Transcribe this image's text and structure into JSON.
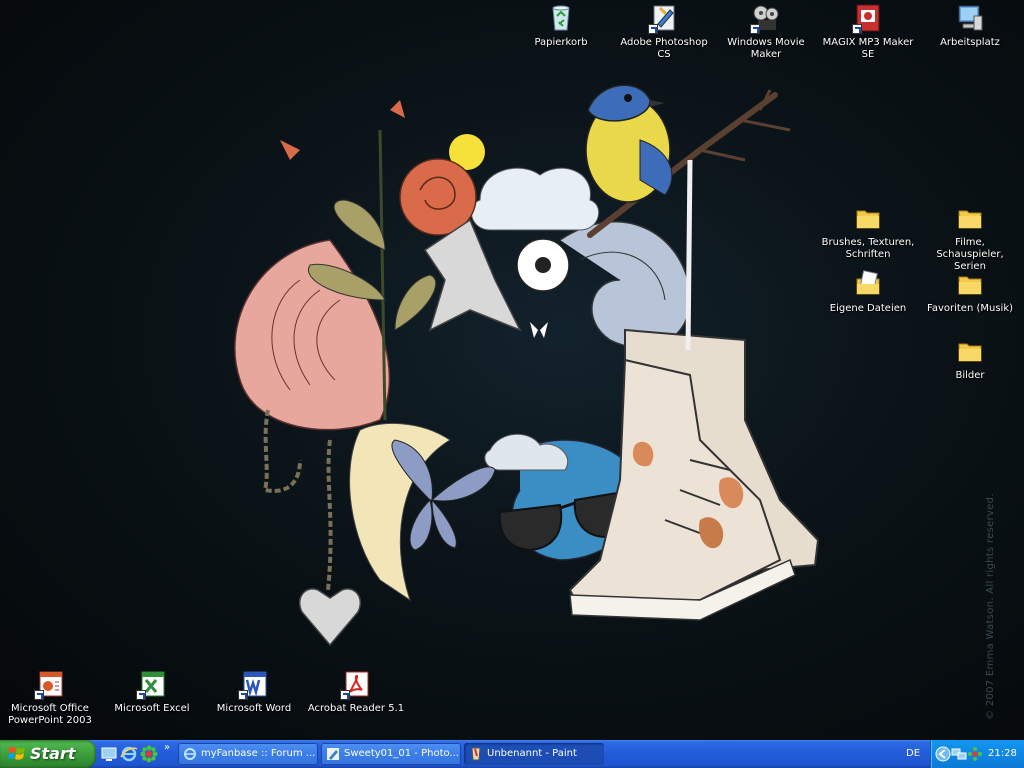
{
  "desktop": {
    "top_icons": [
      {
        "label": "Papierkorb",
        "icon": "recycle-bin-icon"
      },
      {
        "label": "Adobe Photoshop CS",
        "icon": "photoshop-icon"
      },
      {
        "label": "Windows Movie Maker",
        "icon": "movie-maker-icon"
      },
      {
        "label": "MAGIX MP3 Maker SE",
        "icon": "mp3-maker-icon"
      },
      {
        "label": "Arbeitsplatz",
        "icon": "my-computer-icon"
      }
    ],
    "right_icons": [
      {
        "label": "Brushes, Texturen, Schriften",
        "icon": "folder-icon"
      },
      {
        "label": "Filme, Schauspieler, Serien",
        "icon": "folder-icon"
      },
      {
        "label": "Eigene Dateien",
        "icon": "my-documents-icon"
      },
      {
        "label": "Favoriten (Musik)",
        "icon": "folder-icon"
      },
      {
        "label": "Bilder",
        "icon": "folder-icon"
      }
    ],
    "bottom_icons": [
      {
        "label": "Microsoft Office PowerPoint 2003",
        "icon": "powerpoint-icon"
      },
      {
        "label": "Microsoft Excel",
        "icon": "excel-icon"
      },
      {
        "label": "Microsoft Word",
        "icon": "word-icon"
      },
      {
        "label": "Acrobat Reader 5.1",
        "icon": "acrobat-icon"
      }
    ],
    "copyright": "© 2007 Emma Watson. All rights reserved."
  },
  "taskbar": {
    "start_label": "Start",
    "quick_launch": [
      "desktop-icon",
      "internet-explorer-icon",
      "icq-icon"
    ],
    "more_label": "»",
    "tasks": [
      {
        "label": "myFanbase :: Forum ...",
        "icon": "browser-icon",
        "active": false
      },
      {
        "label": "Sweety01_01 - Photo...",
        "icon": "photoshop-icon",
        "active": false
      },
      {
        "label": "Unbenannt - Paint",
        "icon": "paint-icon",
        "active": true
      }
    ],
    "language": "DE",
    "clock": "21:28"
  },
  "colors": {
    "taskbar_blue": "#245edb",
    "start_green": "#3c9b3c",
    "tray_blue": "#0f8ae6",
    "desktop_bg": "#0b1419"
  }
}
